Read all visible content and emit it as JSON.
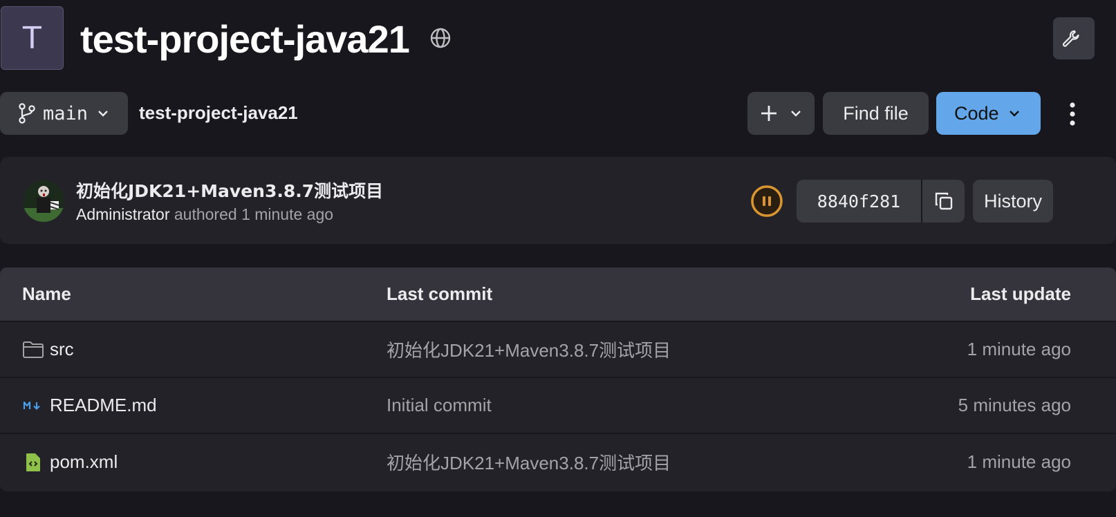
{
  "project": {
    "avatar_letter": "T",
    "title": "test-project-java21",
    "visibility_icon": "globe-icon"
  },
  "toolbar": {
    "branch": "main",
    "breadcrumb": "test-project-java21",
    "find_file_label": "Find file",
    "code_label": "Code"
  },
  "commit": {
    "title": "初始化JDK21+Maven3.8.7测试项目",
    "author": "Administrator",
    "authored_text": "authored 1 minute ago",
    "sha": "8840f281",
    "history_label": "History",
    "pipeline_status": "paused"
  },
  "table": {
    "headers": {
      "name": "Name",
      "last_commit": "Last commit",
      "last_update": "Last update"
    },
    "rows": [
      {
        "icon": "folder-icon",
        "name": "src",
        "last_commit": "初始化JDK21+Maven3.8.7测试项目",
        "last_update": "1 minute ago"
      },
      {
        "icon": "markdown-icon",
        "name": "README.md",
        "last_commit": "Initial commit",
        "last_update": "5 minutes ago"
      },
      {
        "icon": "xml-file-icon",
        "name": "pom.xml",
        "last_commit": "初始化JDK21+Maven3.8.7测试项目",
        "last_update": "1 minute ago"
      }
    ]
  },
  "colors": {
    "background": "#18171d",
    "card": "#232229",
    "button": "#3a3a41",
    "code_button": "#63a6e9",
    "pipeline_paused": "#d99530",
    "project_avatar": "#3c3850"
  }
}
